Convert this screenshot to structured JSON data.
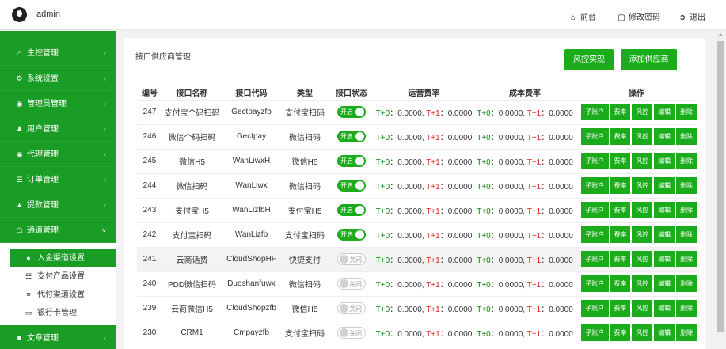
{
  "topbar": {
    "username": "admin",
    "frontend": "前台",
    "change_password": "修改密码",
    "logout": "退出"
  },
  "sidebar": {
    "items": [
      {
        "label": "主控管理",
        "icon": "home-icon"
      },
      {
        "label": "系统设置",
        "icon": "cogs-icon"
      },
      {
        "label": "管理员管理",
        "icon": "user-circle-icon"
      },
      {
        "label": "用户管理",
        "icon": "users-icon"
      },
      {
        "label": "代理管理",
        "icon": "eye-icon"
      },
      {
        "label": "订单管理",
        "icon": "list-icon"
      },
      {
        "label": "提款管理",
        "icon": "money-bag-icon"
      },
      {
        "label": "通道管理",
        "icon": "bank-icon"
      }
    ],
    "submenu": [
      {
        "label": "入金渠道设置",
        "icon": "pin-icon"
      },
      {
        "label": "支付产品设置",
        "icon": "sitemap-icon"
      },
      {
        "label": "代付渠道设置",
        "icon": "sliders-icon"
      },
      {
        "label": "银行卡管理",
        "icon": "card-icon"
      }
    ],
    "last_item": {
      "label": "文章管理",
      "icon": "book-icon"
    }
  },
  "panel": {
    "title": "接口供应商管理",
    "risk_button": "风控实现",
    "add_button": "添加供应商"
  },
  "table": {
    "headers": [
      "编号",
      "接口名称",
      "接口代码",
      "类型",
      "接口状态",
      "运营费率",
      "成本费率",
      "操作"
    ],
    "t0_label": "T+0",
    "t1_label": "T+1",
    "actions": [
      "子账户",
      "费率",
      "风控",
      "编辑",
      "删除"
    ],
    "rows": [
      {
        "id": "247",
        "name": "支付宝个码扫码",
        "code": "Gectpayzfb",
        "type": "支付宝扫码",
        "status": "开启",
        "on": true,
        "op_t0": "0.0000",
        "op_t1": "0.0000",
        "cost_t0": "0.0000",
        "cost_t1": "0.0000"
      },
      {
        "id": "246",
        "name": "微信个码扫码",
        "code": "Gectpay",
        "type": "微信扫码",
        "status": "开启",
        "on": true,
        "op_t0": "0.0000",
        "op_t1": "0.0000",
        "cost_t0": "0.0000",
        "cost_t1": "0.0000"
      },
      {
        "id": "245",
        "name": "微信H5",
        "code": "WanLiwxH",
        "type": "微信H5",
        "status": "开启",
        "on": true,
        "op_t0": "0.0000",
        "op_t1": "0.0000",
        "cost_t0": "0.0000",
        "cost_t1": "0.0000"
      },
      {
        "id": "244",
        "name": "微信扫码",
        "code": "WanLiwx",
        "type": "微信扫码",
        "status": "开启",
        "on": true,
        "op_t0": "0.0000",
        "op_t1": "0.0000",
        "cost_t0": "0.0000",
        "cost_t1": "0.0000"
      },
      {
        "id": "243",
        "name": "支付宝H5",
        "code": "WanLizfbH",
        "type": "支付宝H5",
        "status": "开启",
        "on": true,
        "op_t0": "0.0000",
        "op_t1": "0.0000",
        "cost_t0": "0.0000",
        "cost_t1": "0.0000"
      },
      {
        "id": "242",
        "name": "支付宝扫码",
        "code": "WanLizfb",
        "type": "支付宝扫码",
        "status": "开启",
        "on": true,
        "op_t0": "0.0000",
        "op_t1": "0.0000",
        "cost_t0": "0.0000",
        "cost_t1": "0.0000"
      },
      {
        "id": "241",
        "name": "云商话费",
        "code": "CloudShopHF",
        "type": "快捷支付",
        "status": "关闭",
        "on": false,
        "op_t0": "0.0000",
        "op_t1": "0.0000",
        "cost_t0": "0.0000",
        "cost_t1": "0.0000"
      },
      {
        "id": "240",
        "name": "PDD微信扫码",
        "code": "Duoshanfuwx",
        "type": "微信扫码",
        "status": "关闭",
        "on": false,
        "op_t0": "0.0000",
        "op_t1": "0.0000",
        "cost_t0": "0.0000",
        "cost_t1": "0.0000"
      },
      {
        "id": "239",
        "name": "云商微信H5",
        "code": "CloudShopzfb",
        "type": "微信H5",
        "status": "关闭",
        "on": false,
        "op_t0": "0.0000",
        "op_t1": "0.0000",
        "cost_t0": "0.0000",
        "cost_t1": "0.0000"
      },
      {
        "id": "230",
        "name": "CRM1",
        "code": "Cmpayzfb",
        "type": "支付宝扫码",
        "status": "关闭",
        "on": false,
        "op_t0": "0.0000",
        "op_t1": "0.0000",
        "cost_t0": "0.0000",
        "cost_t1": "0.0000"
      }
    ]
  },
  "colors": {
    "brand_green": "#1a9d25",
    "button_green": "#1aac1a",
    "t0_color": "#0a8a0a",
    "t1_color": "#e02020"
  }
}
